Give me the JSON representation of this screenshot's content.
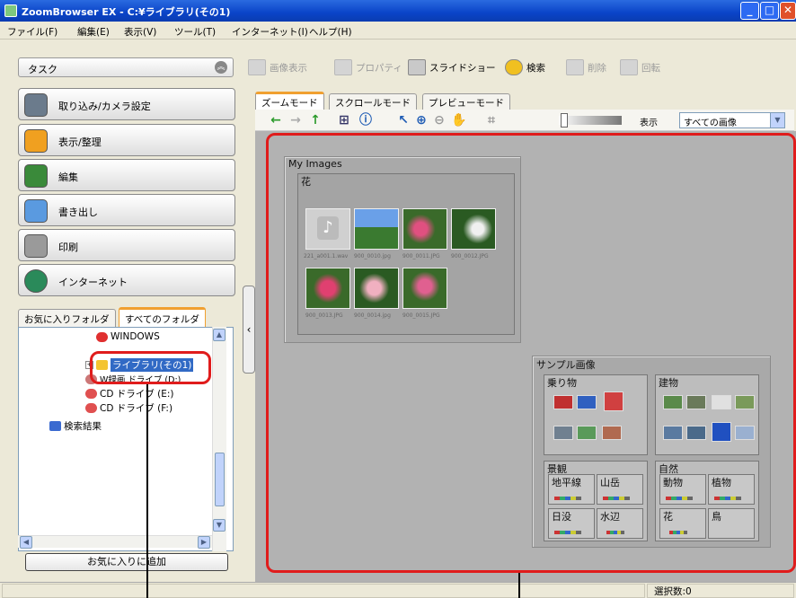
{
  "window": {
    "title": "ZoomBrowser EX - C:¥ライブラリ(その1)"
  },
  "menu": [
    "ファイル(F)",
    "編集(E)",
    "表示(V)",
    "ツール(T)",
    "インターネット(I)",
    "ヘルプ(H)"
  ],
  "task": {
    "label": "タスク"
  },
  "toolbar": {
    "view_image": "画像表示",
    "properties": "プロパティ",
    "slideshow": "スライドショー",
    "search": "検索",
    "delete": "削除",
    "rotate": "回転"
  },
  "categories": [
    "取り込み/カメラ設定",
    "表示/整理",
    "編集",
    "書き出し",
    "印刷",
    "インターネット"
  ],
  "folder_tabs": {
    "favorites": "お気に入りフォルダ",
    "all": "すべてのフォルダ"
  },
  "tree": {
    "windows": "WINDOWS",
    "library": "ライブラリ(その1)",
    "drive_d": "W録画 ドライブ (D:)",
    "cd_e": "CD ドライブ (E:)",
    "cd_f": "CD ドライブ (F:)",
    "search_results": "検索結果"
  },
  "add_favorite": "お気に入りに追加",
  "view_tabs": [
    "ズームモード",
    "スクロールモード",
    "プレビューモード"
  ],
  "viewbar": {
    "label": "表示",
    "filter": "すべての画像"
  },
  "canvas": {
    "my_images": "My Images",
    "flowers_group": "花",
    "captions": [
      "221_a001.1.wav",
      "900_0010.jpg",
      "900_0011.JPG",
      "900_0012.JPG",
      "900_0013.JPG",
      "900_0014.jpg",
      "900_0015.JPG"
    ],
    "sample": "サンプル画像",
    "vehicles": "乗り物",
    "buildings": "建物",
    "scenery": "景観",
    "horizon": "地平線",
    "mountains": "山岳",
    "sunset": "日没",
    "waterside": "水辺",
    "nature": "自然",
    "animals": "動物",
    "plants": "植物",
    "flowers": "花",
    "birds": "鳥"
  },
  "status": {
    "selected": "選択数:0"
  }
}
